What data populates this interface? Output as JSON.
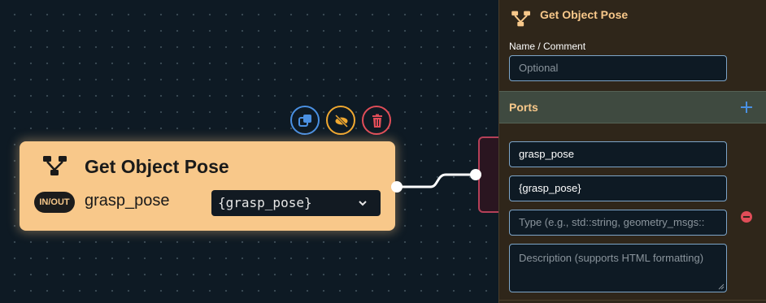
{
  "node": {
    "title": "Get Object Pose",
    "port_badge": "IN/OUT",
    "port_name": "grasp_pose",
    "port_value": "{grasp_pose}",
    "color": "#f8c88a"
  },
  "toolbar": {
    "duplicate_icon": "duplicate-icon",
    "disable_icon": "eye-off-icon",
    "delete_icon": "trash-icon",
    "colors": {
      "duplicate": "#4a90e2",
      "disable": "#f0a830",
      "delete": "#e04d58"
    }
  },
  "panel": {
    "title": "Get Object Pose",
    "icon": "behavior-tree-icon",
    "name_label": "Name / Comment",
    "name_placeholder": "Optional",
    "ports_label": "Ports",
    "port": {
      "name": "grasp_pose",
      "value": "{grasp_pose}",
      "type_placeholder": "Type (e.g., std::string, geometry_msgs::",
      "description_placeholder": "Description (supports HTML formatting)"
    }
  }
}
